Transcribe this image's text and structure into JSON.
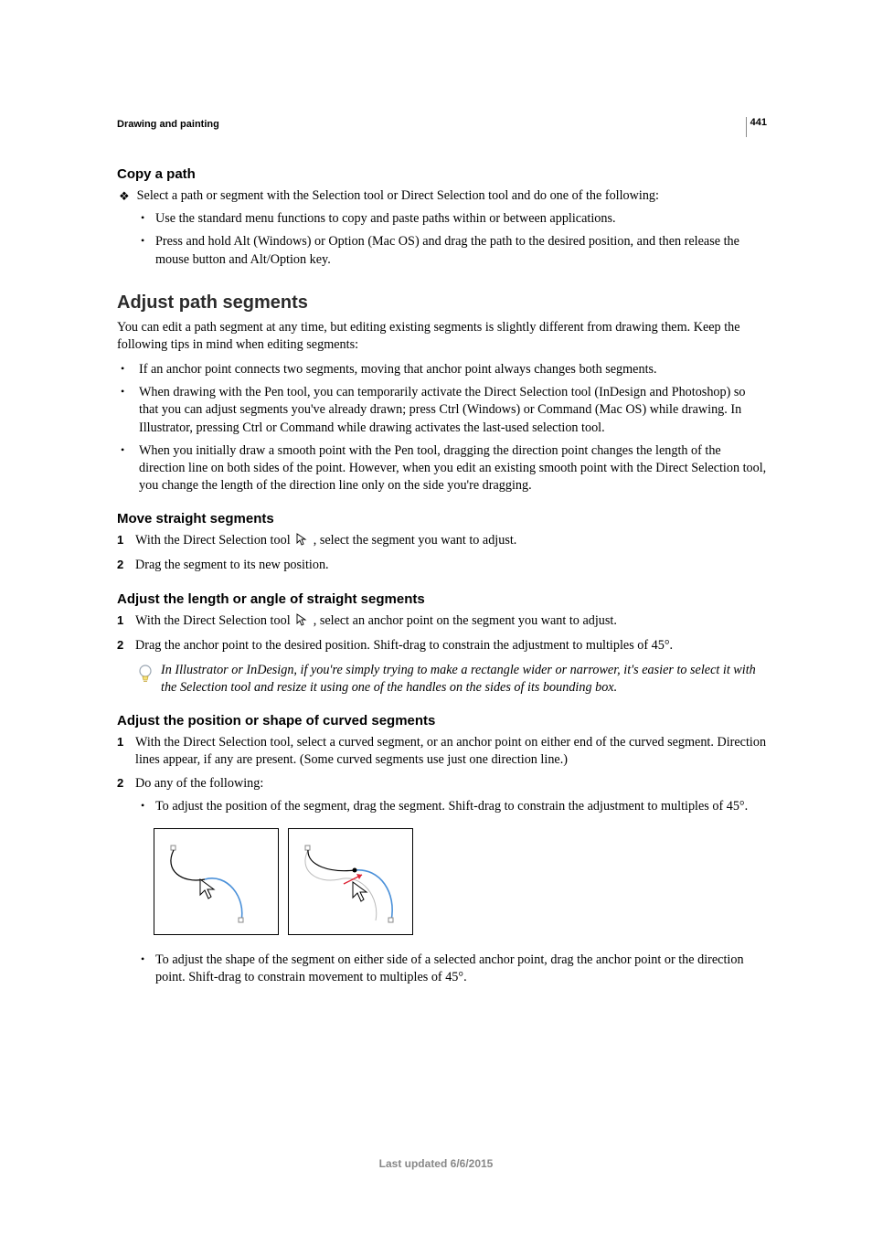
{
  "page": {
    "number": "441",
    "running_head": "Drawing and painting",
    "footer": "Last updated 6/6/2015"
  },
  "copy_path": {
    "heading": "Copy a path",
    "intro": "Select a path or segment with the Selection tool or Direct Selection tool and do one of the following:",
    "bullets": [
      "Use the standard menu functions to copy and paste paths within or between applications.",
      "Press and hold Alt (Windows) or Option (Mac OS) and drag the path to the desired position, and then release the mouse button and Alt/Option key."
    ]
  },
  "adjust_segments": {
    "heading": "Adjust path segments",
    "intro": "You can edit a path segment at any time, but editing existing segments is slightly different from drawing them. Keep the following tips in mind when editing segments:",
    "bullets": [
      "If an anchor point connects two segments, moving that anchor point always changes both segments.",
      "When drawing with the Pen tool, you can temporarily activate the Direct Selection tool (InDesign and Photoshop) so that you can adjust segments you've already drawn; press Ctrl (Windows) or Command (Mac OS) while drawing. In Illustrator, pressing Ctrl or Command while drawing activates the last-used selection tool.",
      "When you initially draw a smooth point with the Pen tool, dragging the direction point changes the length of the direction line on both sides of the point. However, when you edit an existing smooth point with the Direct Selection tool, you change the length of the direction line only on the side you're dragging."
    ]
  },
  "move_straight": {
    "heading": "Move straight segments",
    "step1_a": "With the Direct Selection tool ",
    "step1_b": " , select the segment you want to adjust.",
    "step2": "Drag the segment to its new position."
  },
  "adjust_length": {
    "heading": "Adjust the length or angle of straight segments",
    "step1_a": "With the Direct Selection tool ",
    "step1_b": " , select an anchor point on the segment you want to adjust.",
    "step2": "Drag the anchor point to the desired position. Shift-drag to constrain the adjustment to multiples of 45°.",
    "tip": "In Illustrator or InDesign, if you're simply trying to make a rectangle wider or narrower, it's easier to select it with the Selection tool and resize it using one of the handles on the sides of its bounding box."
  },
  "adjust_curved": {
    "heading": "Adjust the position or shape of curved segments",
    "step1": "With the Direct Selection tool, select a curved segment, or an anchor point on either end of the curved segment. Direction lines appear, if any are present. (Some curved segments use just one direction line.)",
    "step2": "Do any of the following:",
    "sub_bullets": [
      "To adjust the position of the segment, drag the segment. Shift-drag to constrain the adjustment to multiples of 45°.",
      "To adjust the shape of the segment on either side of a selected anchor point, drag the anchor point or the direction point. Shift-drag to constrain movement to multiples of 45°."
    ]
  }
}
